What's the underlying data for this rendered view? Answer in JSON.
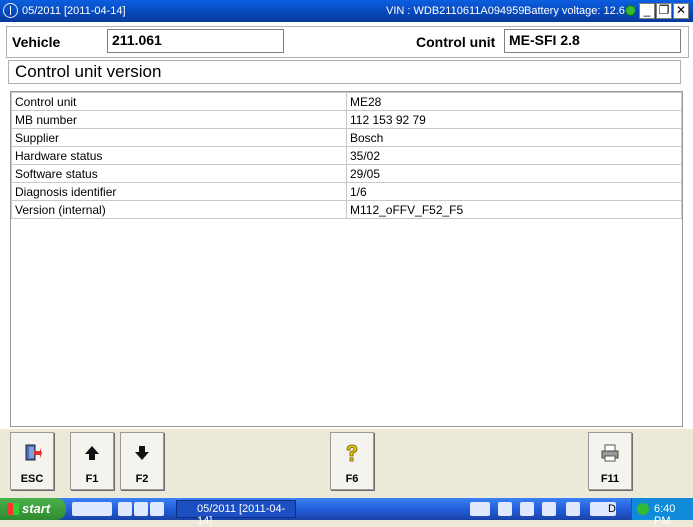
{
  "window": {
    "title": "05/2011 [2011-04-14]",
    "vin": "VIN : WDB2110611A094959",
    "battery": "Battery voltage: 12.6 V",
    "minimize": "_",
    "restore": "❐",
    "close": "✕"
  },
  "header": {
    "vehicle_label": "Vehicle",
    "vehicle_value": "211.061",
    "control_unit_label": "Control unit",
    "control_unit_value": "ME-SFI 2.8"
  },
  "section_title": "Control unit version",
  "table": {
    "rows": [
      [
        "Control unit",
        "ME28"
      ],
      [
        "MB number",
        "112 153 92 79"
      ],
      [
        "Supplier",
        "Bosch"
      ],
      [
        "Hardware status",
        "35/02"
      ],
      [
        "Software status",
        "29/05"
      ],
      [
        "Diagnosis identifier",
        "1/6"
      ],
      [
        "Version (internal)",
        "M112_oFFV_F52_F5"
      ]
    ]
  },
  "buttons": {
    "esc": "ESC",
    "f1": "F1",
    "f2": "F2",
    "f6": "F6",
    "f11": "F11"
  },
  "taskbar": {
    "start": "start",
    "task_label": "05/2011 [2011-04-14]",
    "clock": "6:40 PM",
    "tray_letter": "D"
  }
}
